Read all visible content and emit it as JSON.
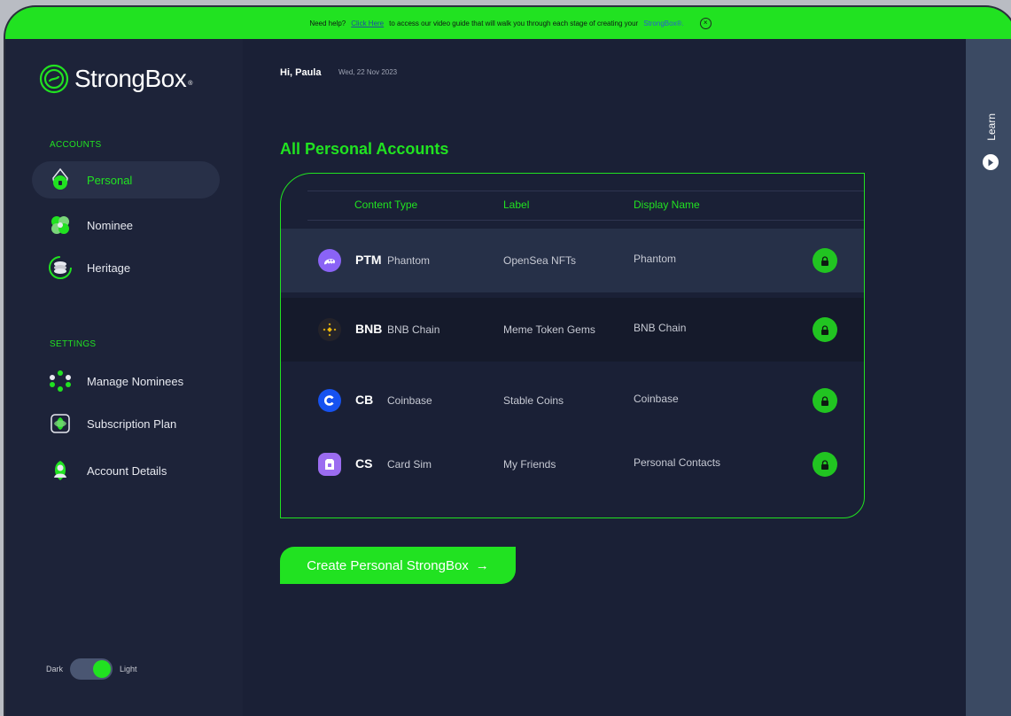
{
  "banner": {
    "prefix": "Need help?",
    "link": "Click Here",
    "middle": "to access our video guide that will walk you through each stage of creating your",
    "brand": "StrongBox®.",
    "close_icon": "×"
  },
  "brand": {
    "name": "StrongBox",
    "reg": "®"
  },
  "sidebar": {
    "accounts_heading": "ACCOUNTS",
    "accounts": [
      {
        "label": "Personal",
        "icon": "personal-icon",
        "active": true
      },
      {
        "label": "Nominee",
        "icon": "nominee-icon"
      },
      {
        "label": "Heritage",
        "icon": "heritage-icon"
      }
    ],
    "settings_heading": "SETTINGS",
    "settings": [
      {
        "label": "Manage Nominees",
        "icon": "manage-nominees-icon"
      },
      {
        "label": "Subscription Plan",
        "icon": "subscription-icon"
      },
      {
        "label": "Account Details",
        "icon": "account-details-icon"
      }
    ],
    "theme": {
      "dark": "Dark",
      "light": "Light",
      "selected": "Light"
    }
  },
  "header": {
    "greeting": "Hi, Paula",
    "date": "Wed, 22 Nov 2023"
  },
  "main": {
    "title": "All Personal Accounts",
    "columns": [
      "Content Type",
      "Label",
      "Display Name"
    ],
    "rows": [
      {
        "ticker": "PTM",
        "name": "Phantom",
        "label": "OpenSea NFTs",
        "display": "Phantom",
        "icon": "phantom-icon",
        "color": "#8a63f6"
      },
      {
        "ticker": "BNB",
        "name": "BNB Chain",
        "label": "Meme Token Gems",
        "display": "BNB Chain",
        "icon": "bnb-icon",
        "color": "#f0b90b"
      },
      {
        "ticker": "CB",
        "name": "Coinbase",
        "label": "Stable Coins",
        "display": "Coinbase",
        "icon": "coinbase-icon",
        "color": "#1652f0"
      },
      {
        "ticker": "CS",
        "name": "Card Sim",
        "label": "My Friends",
        "display": "Personal Contacts",
        "icon": "card-sim-icon",
        "color": "#9b6cf0"
      }
    ],
    "cta": "Create Personal StrongBox",
    "cta_arrow": "→"
  },
  "learn": {
    "label": "Learn"
  },
  "colors": {
    "accent": "#21e221",
    "bg": "#1a2036",
    "sidebar": "#1d2339",
    "learn": "#3b4a63"
  }
}
